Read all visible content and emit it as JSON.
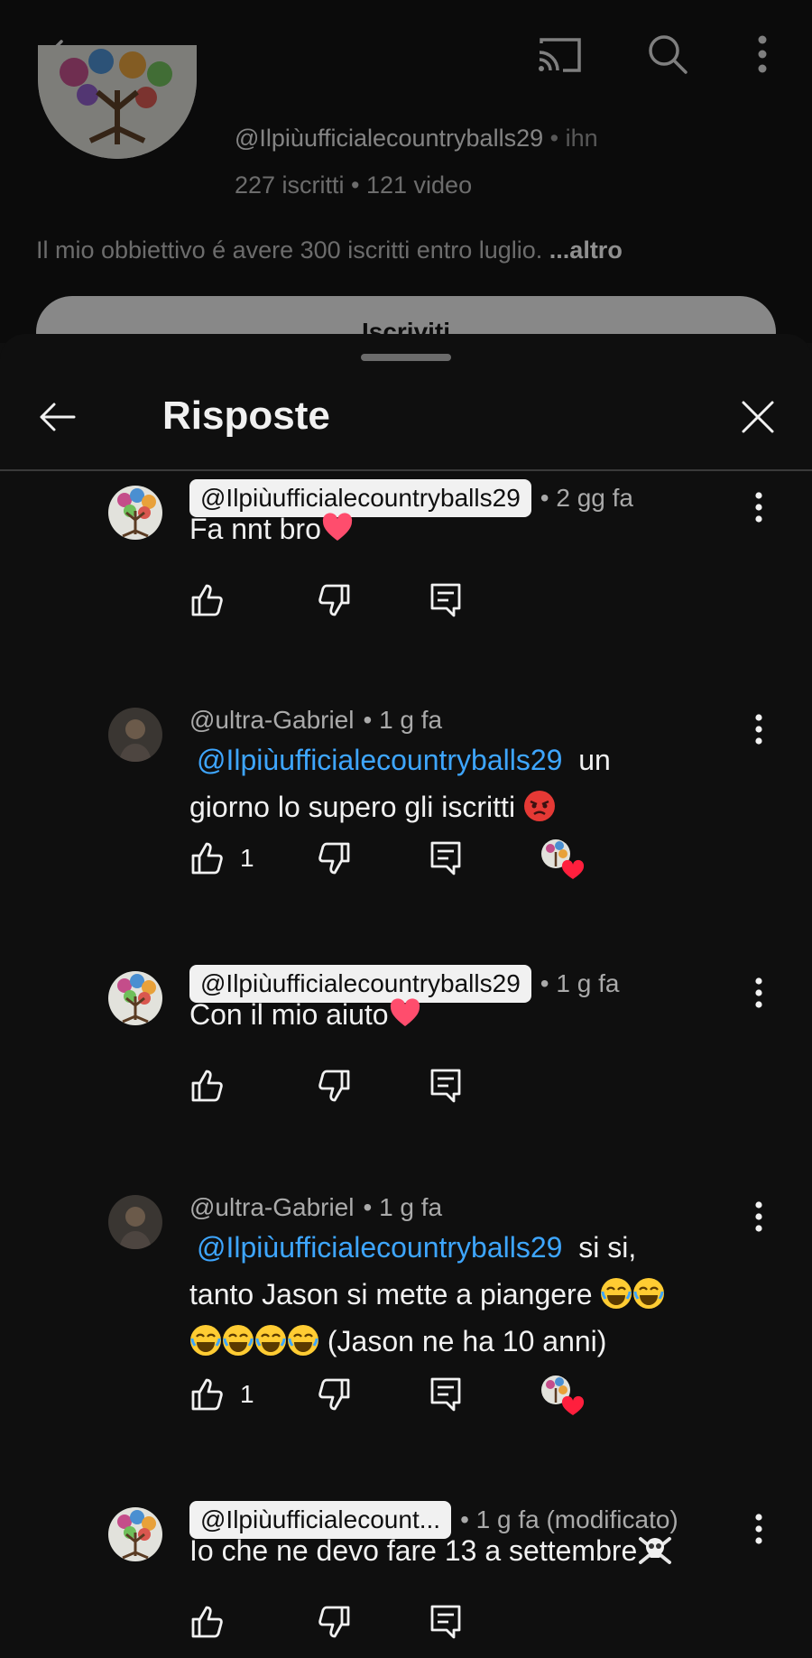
{
  "channel": {
    "handle": "@Ilpiùufficialecountryballs29",
    "separator": "•",
    "handle_suffix": "ihn",
    "stats": "227 iscritti • 121 video",
    "description": "Il mio obbiettivo é avere 300 iscritti entro luglio.",
    "more_label": "...altro",
    "subscribe_label": "Iscriviti"
  },
  "sheet": {
    "title": "Risposte"
  },
  "replies": [
    {
      "author": "@Ilpiùufficialecountryballs29",
      "author_is_creator": true,
      "meta": "• 2 gg fa",
      "mention": "",
      "text": "Fa nnt bro",
      "emoji": [
        "heart"
      ],
      "likes": "",
      "creator_hearted": false
    },
    {
      "author": "@ultra-Gabriel",
      "author_is_creator": false,
      "meta": "• 1 g fa",
      "mention": "@Ilpiùufficialecountryballs29",
      "text_line1": "un",
      "text": "giorno lo supero gli iscritti",
      "emoji": [
        "angry"
      ],
      "likes": "1",
      "creator_hearted": true
    },
    {
      "author": "@Ilpiùufficialecountryballs29",
      "author_is_creator": true,
      "meta": "• 1 g fa",
      "mention": "",
      "text": "Con il mio aiuto",
      "emoji": [
        "heart"
      ],
      "likes": "",
      "creator_hearted": false
    },
    {
      "author": "@ultra-Gabriel",
      "author_is_creator": false,
      "meta": "• 1 g fa",
      "mention": "@Ilpiùufficialecountryballs29",
      "text_line1": "si si,",
      "text_line2": "tanto Jason si mette a piangere",
      "text": "(Jason ne ha 10 anni)",
      "emoji": [
        "joy",
        "joy",
        "joy",
        "joy",
        "joy",
        "joy"
      ],
      "likes": "1",
      "creator_hearted": true
    },
    {
      "author": "@Ilpiùufficialecount...",
      "author_is_creator": true,
      "meta": "• 1 g fa (modificato)",
      "mention": "",
      "text": "Io che ne devo fare 13 a settembre",
      "emoji": [
        "skull-crossbones"
      ],
      "likes": "",
      "creator_hearted": false
    }
  ],
  "icons": {
    "back": "arrow-left-icon",
    "cast": "cast-icon",
    "search": "search-icon",
    "more": "more-vert-icon",
    "close": "close-icon",
    "like": "thumb-up-icon",
    "dislike": "thumb-down-icon",
    "reply": "comment-icon"
  },
  "colors": {
    "background": "#0f0f0f",
    "text": "#f1f1f1",
    "secondary_text": "#aaaaaa",
    "mention": "#3ea6ff",
    "chip_bg": "#f1f1f1",
    "heart": "#ff4d6d"
  }
}
